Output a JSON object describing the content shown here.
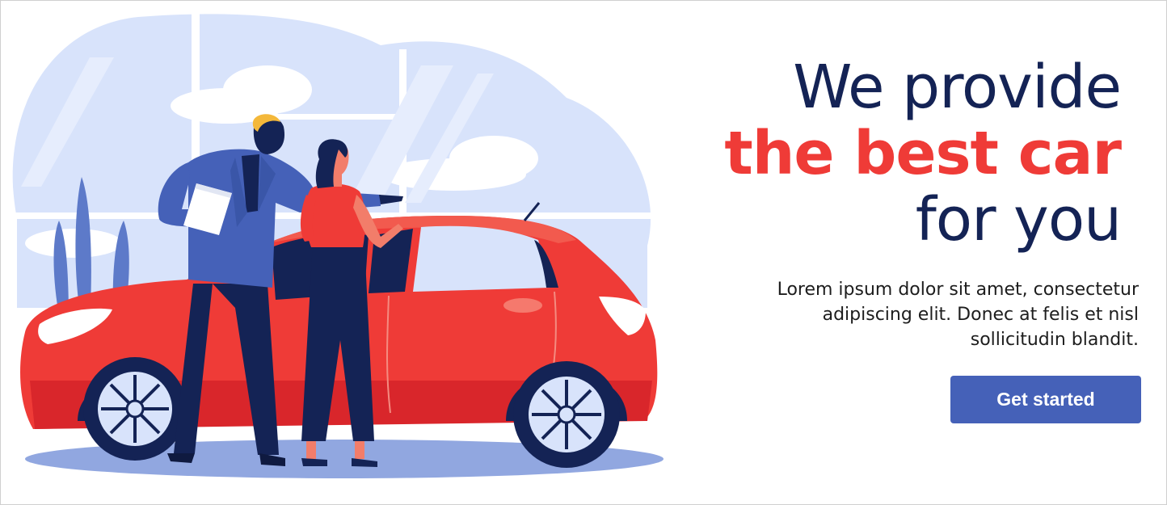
{
  "hero": {
    "headline": {
      "line1": "We provide",
      "line2": "the best car",
      "line3": "for you"
    },
    "description": {
      "line1": "Lorem ipsum dolor sit amet, consectetur",
      "line2": "adipiscing elit. Donec at felis et nisl",
      "line3": "sollicitudin blandit."
    },
    "cta_label": "Get started"
  },
  "colors": {
    "navy": "#142355",
    "accent_red": "#ef3b37",
    "button_blue": "#4561b8",
    "background_blue": "#d8e3fb"
  },
  "illustration": {
    "subject": "car-dealer-showing-red-hatchback-illustration"
  }
}
